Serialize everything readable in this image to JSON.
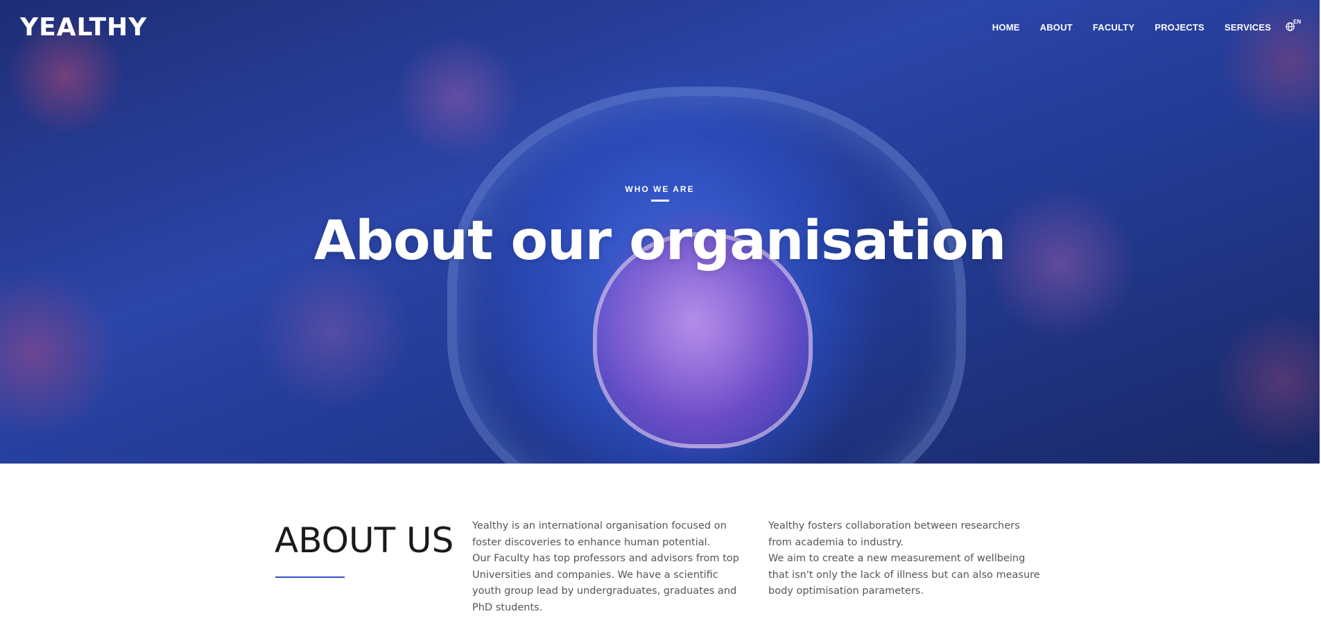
{
  "brand": {
    "logo_text": "YEALTHY"
  },
  "nav": {
    "items": [
      {
        "label": "HOME"
      },
      {
        "label": "ABOUT"
      },
      {
        "label": "FACULTY"
      },
      {
        "label": "PROJECTS"
      },
      {
        "label": "SERVICES"
      }
    ],
    "language": {
      "code": "EN",
      "icon": "globe-icon"
    }
  },
  "hero": {
    "eyebrow": "WHO WE ARE",
    "title": "About our organisation"
  },
  "about": {
    "title": "ABOUT US",
    "col1_p1": "Yealthy is an international organisation focused on foster discoveries to enhance human potential.",
    "col1_p2": "Our Faculty has top professors and advisors from top Universities and companies. We have a scientific youth group lead by undergraduates, graduates and PhD students.",
    "col2_p1": "Yealthy fosters collaboration between researchers from academia to industry.",
    "col2_p2": "We aim to create a new measurement of wellbeing that isn't only the lack of illness but can also measure body optimisation parameters."
  },
  "colors": {
    "accent": "#2f4fc4",
    "hero_base": "#2b45a8",
    "heading_text": "#1a1a1a",
    "body_text": "#555555"
  }
}
